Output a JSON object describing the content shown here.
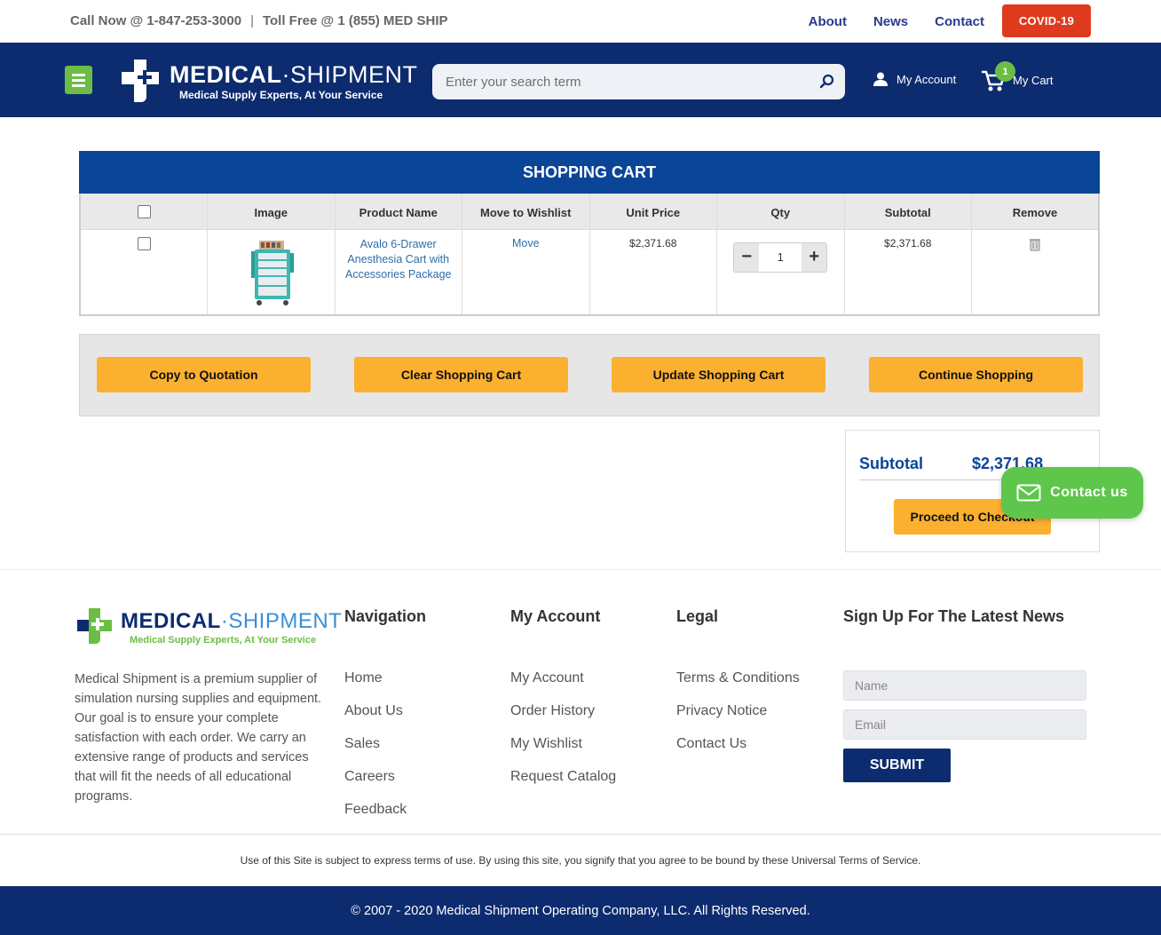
{
  "topbar": {
    "call_now": "Call Now @ 1-847-253-3000",
    "separator": "|",
    "toll_free": "Toll Free @ 1 (855) MED SHIP",
    "links": [
      "About",
      "News",
      "Contact"
    ],
    "covid": "COVID-19"
  },
  "header": {
    "logo_brand_a": "MEDICAL",
    "logo_dot": "·",
    "logo_brand_b": "SHIPMENT",
    "logo_tagline": "Medical Supply Experts, At Your Service",
    "search_placeholder": "Enter your search term",
    "my_account": "My Account",
    "my_cart": "My Cart",
    "cart_count": "1"
  },
  "cart": {
    "title": "SHOPPING CART",
    "columns": [
      "Image",
      "Product Name",
      "Move to Wishlist",
      "Unit Price",
      "Qty",
      "Subtotal",
      "Remove"
    ],
    "items": [
      {
        "name": "Avalo 6-Drawer Anesthesia Cart with Accessories Package",
        "move": "Move",
        "unit_price": "$2,371.68",
        "qty": "1",
        "subtotal": "$2,371.68"
      }
    ],
    "qty_minus": "−",
    "qty_plus": "+"
  },
  "actions": {
    "copy": "Copy to Quotation",
    "clear": "Clear Shopping Cart",
    "update": "Update Shopping Cart",
    "continue": "Continue Shopping"
  },
  "summary": {
    "label": "Subtotal",
    "value": "$2,371.68",
    "checkout": "Proceed to Checkout"
  },
  "contact_float": "Contact us",
  "footer": {
    "logo_brand_a": "MEDICAL",
    "logo_dot": "·",
    "logo_brand_b": "SHIPMENT",
    "logo_tagline": "Medical Supply Experts, At Your Service",
    "about": "Medical Shipment is a premium supplier of simulation nursing supplies and equipment. Our goal is to ensure your complete satisfaction with each order. We carry an extensive range of products and services that will fit the needs of all educational programs.",
    "navigation": {
      "title": "Navigation",
      "links": [
        "Home",
        "About Us",
        "Sales",
        "Careers",
        "Feedback"
      ]
    },
    "my_account": {
      "title": "My Account",
      "links": [
        "My Account",
        "Order History",
        "My Wishlist",
        "Request Catalog"
      ]
    },
    "legal": {
      "title": "Legal",
      "links": [
        "Terms & Conditions",
        "Privacy Notice",
        "Contact Us"
      ]
    },
    "newsletter": {
      "title": "Sign Up For The Latest News",
      "name_placeholder": "Name",
      "email_placeholder": "Email",
      "submit": "SUBMIT"
    },
    "terms": "Use of this Site is subject to express terms of use. By using this site, you signify that you agree to be bound by these Universal Terms of Service.",
    "copyright": "© 2007 - 2020 Medical Shipment Operating Company, LLC. All Rights Reserved."
  },
  "colors": {
    "navy": "#0d2b6f",
    "cart_header": "#0a4597",
    "orange": "#fbb030",
    "green": "#6cbd45",
    "covid_red": "#e03a1e"
  },
  "icons": [
    "menu-icon",
    "search-icon",
    "user-icon",
    "cart-icon",
    "trash-icon",
    "mail-icon",
    "medical-cross-logo-icon"
  ]
}
